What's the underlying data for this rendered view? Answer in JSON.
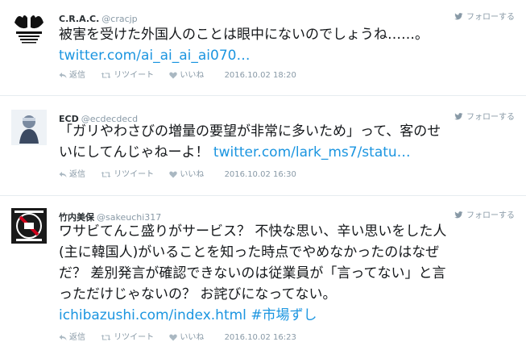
{
  "tweets": [
    {
      "name": "C.R.A.C.",
      "handle": "@cracjp",
      "follow_label": "フォローする",
      "lines": [
        "被害を受けた外国人のことは眼中にないのでしょうね……。"
      ],
      "link": "twitter.com/ai_ai_ai_ai070…",
      "reply_label": "返信",
      "retweet_label": "リツイート",
      "like_label": "いいね",
      "timestamp": "2016.10.02 18:20"
    },
    {
      "name": "ECD",
      "handle": "@ecdecdecd",
      "follow_label": "フォローする",
      "line1": "「ガリやわさびの増量の要望が非常に多いため」って、客のせ",
      "line2": "いにしてんじゃねーよ！ ",
      "link": "twitter.com/lark_ms7/statu…",
      "reply_label": "返信",
      "retweet_label": "リツイート",
      "like_label": "いいね",
      "timestamp": "2016.10.02 16:30"
    },
    {
      "name": "竹内美保",
      "handle": "@sakeuchi317",
      "follow_label": "フォローする",
      "lines": [
        "ワサビてんこ盛りがサービス？ 不快な思い、辛い思いをした人",
        "(主に韓国人)がいることを知った時点でやめなかったのはなぜ",
        "だ？ 差別発言が確認できないのは従業員が「言ってない」と言",
        "っただけじゃないの？ お詫びになってない。"
      ],
      "link": "ichibazushi.com/index.html",
      "hashtag": "#市場ずし",
      "reply_label": "返信",
      "retweet_label": "リツイート",
      "like_label": "いいね",
      "timestamp": "2016.10.02 16:23"
    }
  ],
  "colors": {
    "link": "#1b95e0",
    "meta": "#8899a6",
    "text": "#14171a",
    "divider": "#e6ecf0"
  }
}
